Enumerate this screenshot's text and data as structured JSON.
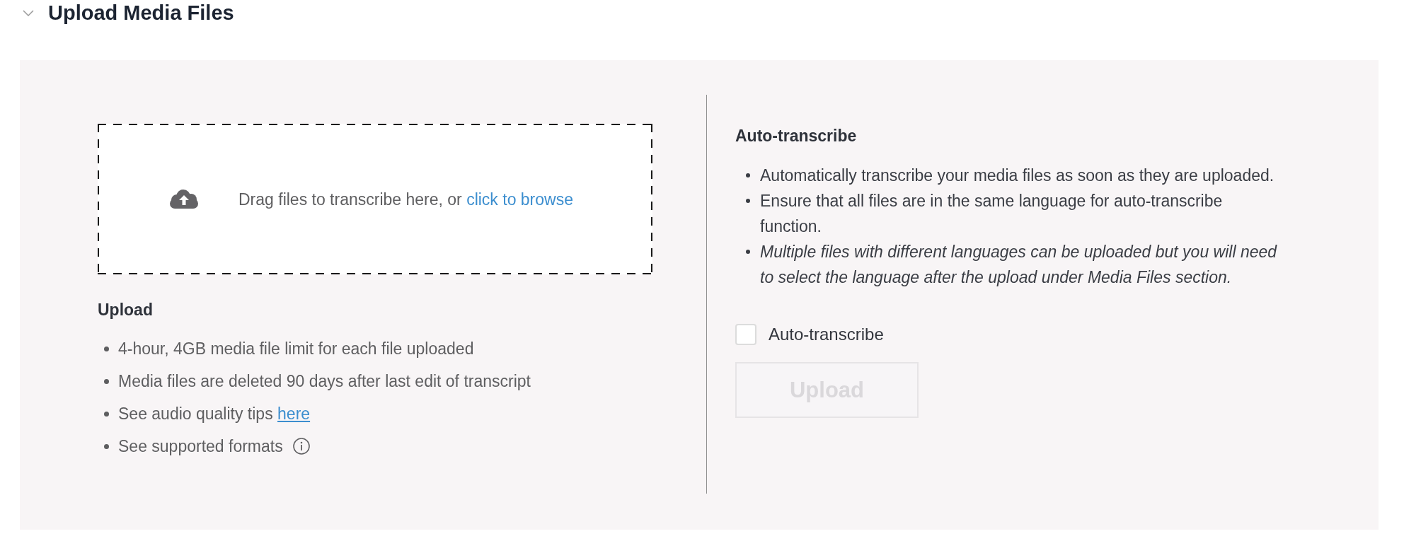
{
  "section": {
    "title": "Upload Media Files",
    "expanded": true
  },
  "dropzone": {
    "text": "Drag files to transcribe here, or ",
    "link": "click to browse"
  },
  "upload_info": {
    "heading": "Upload",
    "items": [
      {
        "text": "4-hour, 4GB media file limit for each file uploaded",
        "info": false
      },
      {
        "text": "Media files are deleted 90 days after last edit of transcript",
        "info": false
      },
      {
        "text": "See audio quality tips ",
        "link": "here",
        "info": false
      },
      {
        "text": "See supported formats",
        "info": true
      }
    ]
  },
  "auto_transcribe": {
    "heading": "Auto-transcribe",
    "items": [
      {
        "text": "Automatically transcribe your media files as soon as they are uploaded.",
        "italic": false
      },
      {
        "text": "Ensure that all files are in the same language for auto-transcribe function.",
        "italic": false
      },
      {
        "text": "Multiple files with different languages can be uploaded but you will need to select the language after the upload under Media Files section.",
        "italic": true
      }
    ],
    "checkbox": {
      "label": "Auto-transcribe",
      "checked": false
    },
    "upload_button": {
      "label": "Upload",
      "disabled": true
    }
  }
}
